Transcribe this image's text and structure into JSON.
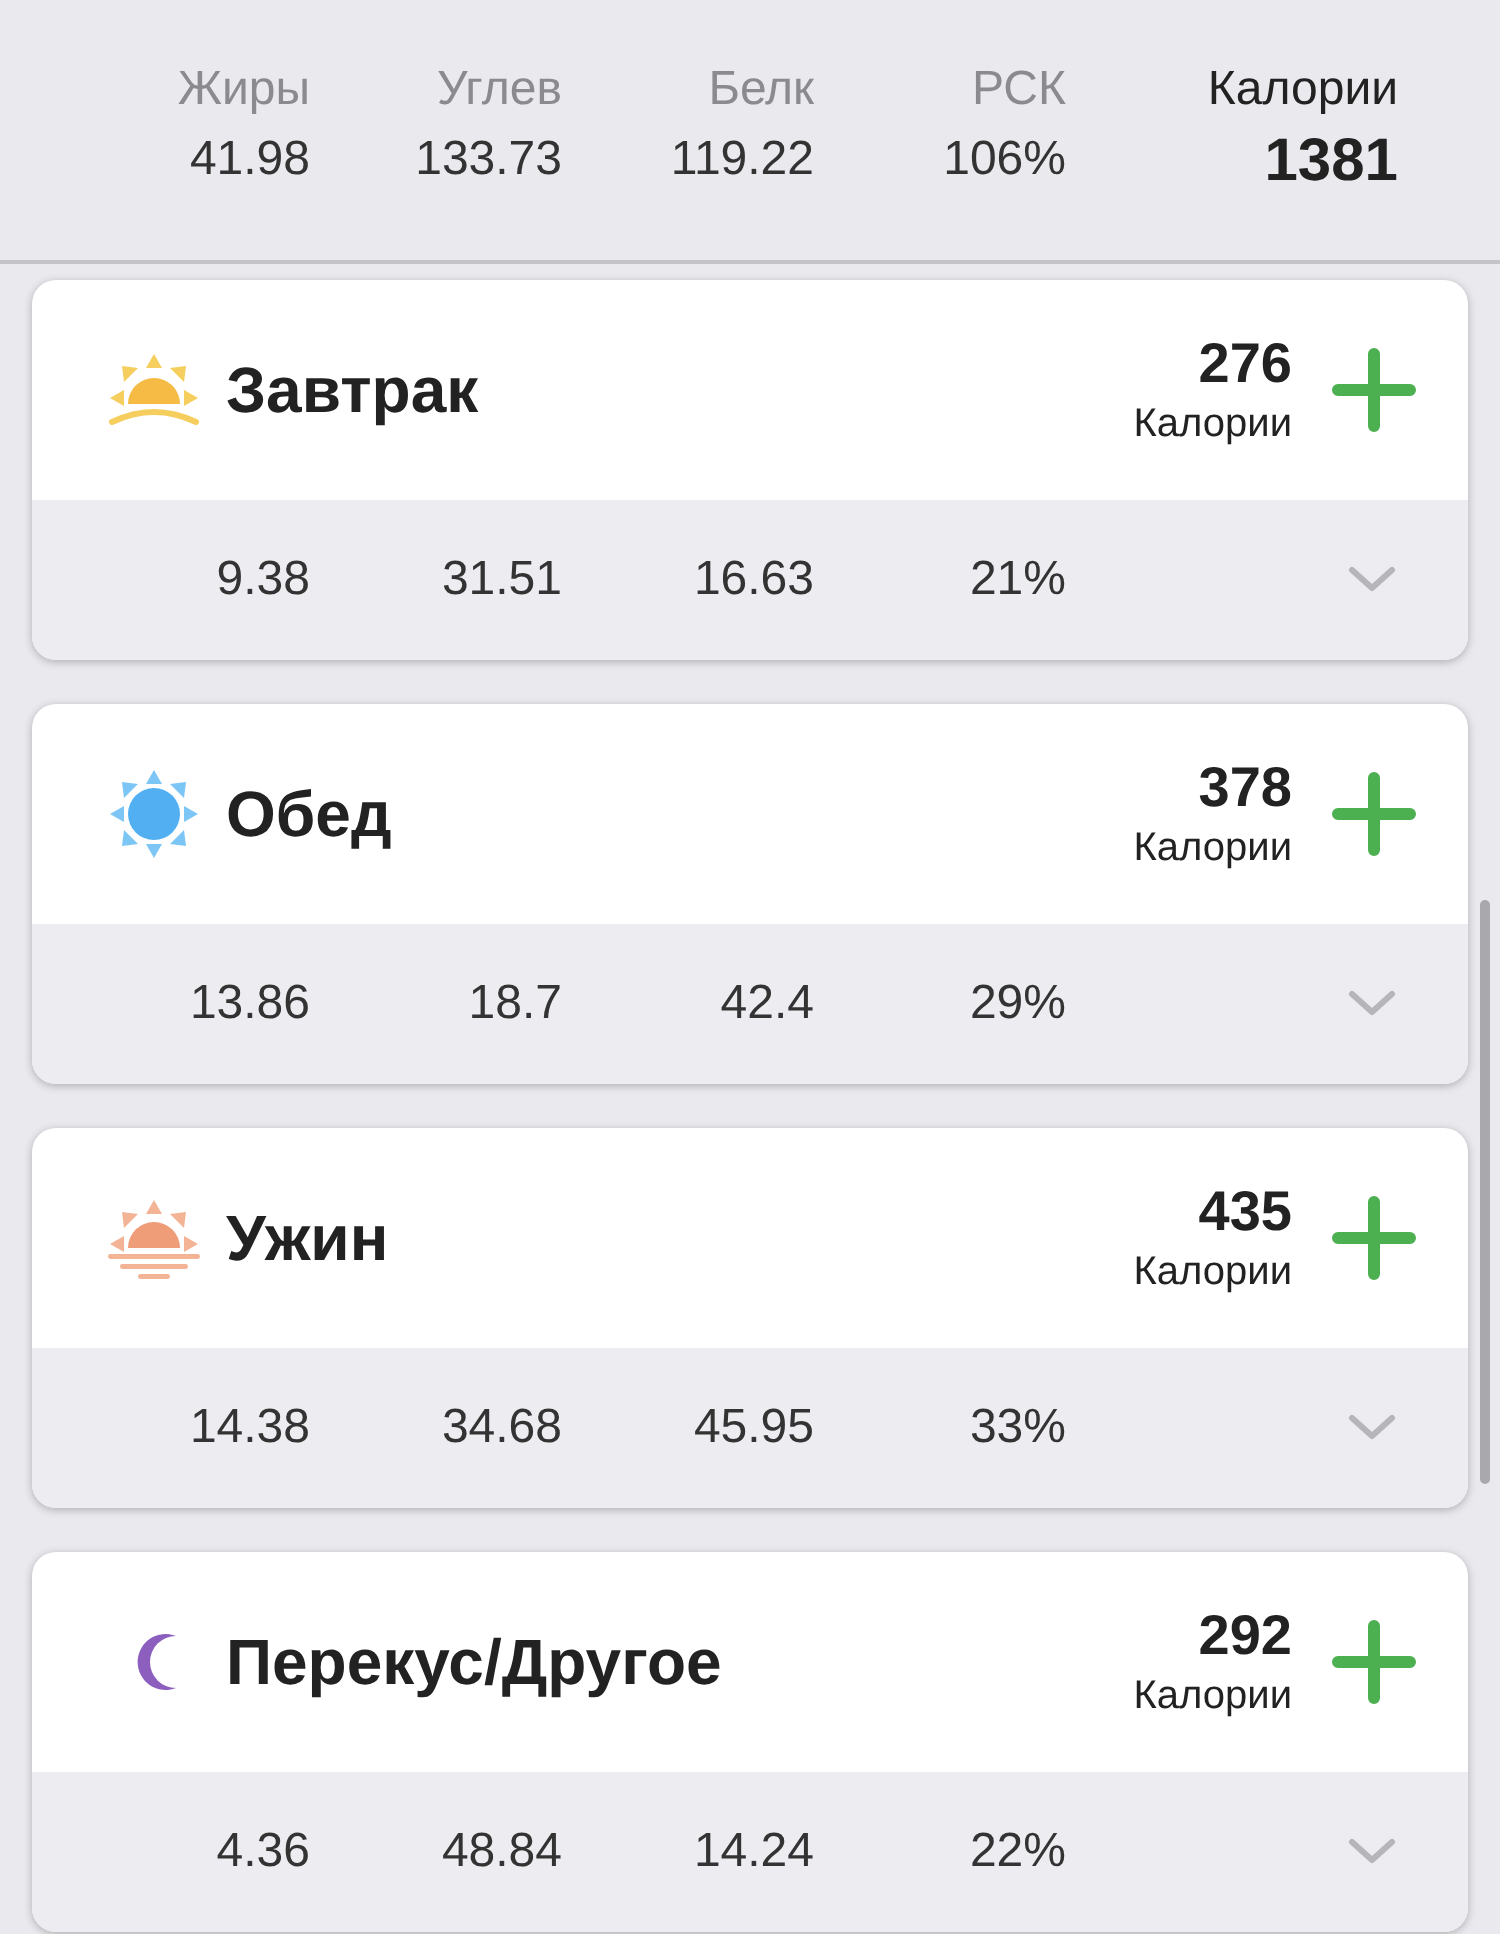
{
  "summary": {
    "columns": [
      {
        "label": "Жиры",
        "value": "41.98"
      },
      {
        "label": "Углев",
        "value": "133.73"
      },
      {
        "label": "Белк",
        "value": "119.22"
      },
      {
        "label": "РСК",
        "value": "106%"
      }
    ],
    "calories_label": "Калории",
    "calories": "1381"
  },
  "meals": [
    {
      "kind": "sunrise",
      "title": "Завтрак",
      "calories": "276",
      "calories_label": "Калории",
      "values": [
        "9.38",
        "31.51",
        "16.63",
        "21%"
      ]
    },
    {
      "kind": "sun",
      "title": "Обед",
      "calories": "378",
      "calories_label": "Калории",
      "values": [
        "13.86",
        "18.7",
        "42.4",
        "29%"
      ]
    },
    {
      "kind": "sunset",
      "title": "Ужин",
      "calories": "435",
      "calories_label": "Калории",
      "values": [
        "14.38",
        "34.68",
        "45.95",
        "33%"
      ]
    },
    {
      "kind": "moon",
      "title": "Перекус/Другое",
      "calories": "292",
      "calories_label": "Калории",
      "values": [
        "4.36",
        "48.84",
        "14.24",
        "22%"
      ]
    }
  ]
}
